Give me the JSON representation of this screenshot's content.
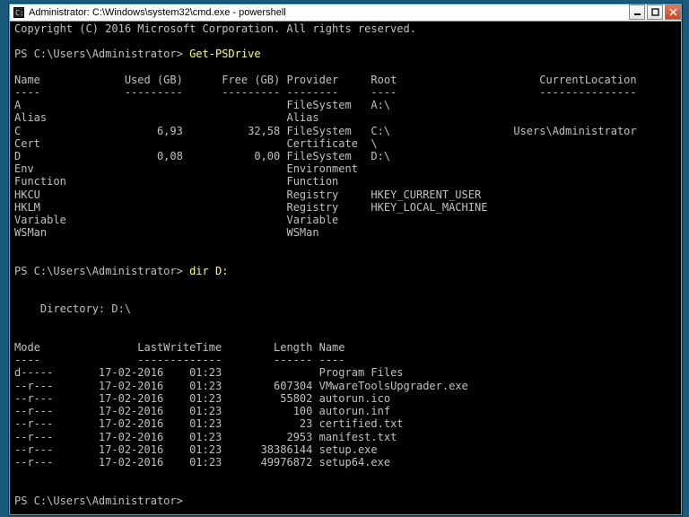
{
  "title": "Administrator: C:\\Windows\\system32\\cmd.exe - powershell",
  "copyright": "Copyright (C) 2016 Microsoft Corporation. All rights reserved.",
  "prompt": "PS C:\\Users\\Administrator>",
  "cmd1": "Get-PSDrive",
  "cmd2": "dir D:",
  "psdrive": {
    "header": {
      "c0": "Name",
      "c1": "Used (GB)",
      "c2": "Free (GB)",
      "c3": "Provider",
      "c4": "Root",
      "c5": "CurrentLocation"
    },
    "dash": {
      "c0": "----",
      "c1": "---------",
      "c2": "---------",
      "c3": "--------",
      "c4": "----",
      "c5": "---------------"
    },
    "rows": [
      {
        "name": "A",
        "used": "",
        "free": "",
        "provider": "FileSystem",
        "root": "A:\\",
        "loc": ""
      },
      {
        "name": "Alias",
        "used": "",
        "free": "",
        "provider": "Alias",
        "root": "",
        "loc": ""
      },
      {
        "name": "C",
        "used": "6,93",
        "free": "32,58",
        "provider": "FileSystem",
        "root": "C:\\",
        "loc": "Users\\Administrator"
      },
      {
        "name": "Cert",
        "used": "",
        "free": "",
        "provider": "Certificate",
        "root": "\\",
        "loc": ""
      },
      {
        "name": "D",
        "used": "0,08",
        "free": "0,00",
        "provider": "FileSystem",
        "root": "D:\\",
        "loc": ""
      },
      {
        "name": "Env",
        "used": "",
        "free": "",
        "provider": "Environment",
        "root": "",
        "loc": ""
      },
      {
        "name": "Function",
        "used": "",
        "free": "",
        "provider": "Function",
        "root": "",
        "loc": ""
      },
      {
        "name": "HKCU",
        "used": "",
        "free": "",
        "provider": "Registry",
        "root": "HKEY_CURRENT_USER",
        "loc": ""
      },
      {
        "name": "HKLM",
        "used": "",
        "free": "",
        "provider": "Registry",
        "root": "HKEY_LOCAL_MACHINE",
        "loc": ""
      },
      {
        "name": "Variable",
        "used": "",
        "free": "",
        "provider": "Variable",
        "root": "",
        "loc": ""
      },
      {
        "name": "WSMan",
        "used": "",
        "free": "",
        "provider": "WSMan",
        "root": "",
        "loc": ""
      }
    ]
  },
  "dir": {
    "heading": "    Directory: D:\\",
    "header": {
      "c0": "Mode",
      "c1": "LastWriteTime",
      "c2": "Length",
      "c3": "Name"
    },
    "dash": {
      "c0": "----",
      "c1": "-------------",
      "c2": "------",
      "c3": "----"
    },
    "rows": [
      {
        "mode": "d-----",
        "date": "17-02-2016",
        "time": "01:23",
        "length": "",
        "name": "Program Files"
      },
      {
        "mode": "--r---",
        "date": "17-02-2016",
        "time": "01:23",
        "length": "607304",
        "name": "VMwareToolsUpgrader.exe"
      },
      {
        "mode": "--r---",
        "date": "17-02-2016",
        "time": "01:23",
        "length": "55802",
        "name": "autorun.ico"
      },
      {
        "mode": "--r---",
        "date": "17-02-2016",
        "time": "01:23",
        "length": "100",
        "name": "autorun.inf"
      },
      {
        "mode": "--r---",
        "date": "17-02-2016",
        "time": "01:23",
        "length": "23",
        "name": "certified.txt"
      },
      {
        "mode": "--r---",
        "date": "17-02-2016",
        "time": "01:23",
        "length": "2953",
        "name": "manifest.txt"
      },
      {
        "mode": "--r---",
        "date": "17-02-2016",
        "time": "01:23",
        "length": "38386144",
        "name": "setup.exe"
      },
      {
        "mode": "--r---",
        "date": "17-02-2016",
        "time": "01:23",
        "length": "49976872",
        "name": "setup64.exe"
      }
    ]
  }
}
